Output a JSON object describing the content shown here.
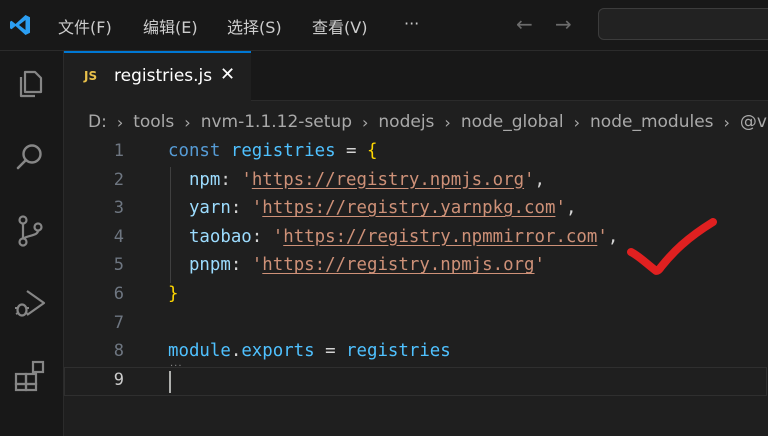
{
  "menu": {
    "file": "文件(F)",
    "edit": "编辑(E)",
    "selection": "选择(S)",
    "view": "查看(V)",
    "more": "···"
  },
  "nav": {
    "back": "←",
    "forward": "→"
  },
  "tab": {
    "badge": "JS",
    "filename": "registries.js",
    "close": "✕"
  },
  "breadcrumb": [
    "D:",
    "tools",
    "nvm-1.1.12-setup",
    "nodejs",
    "node_global",
    "node_modules",
    "@vu"
  ],
  "lines": [
    {
      "n": "1",
      "parts": [
        {
          "t": "const",
          "c": "kw"
        },
        {
          "t": " "
        },
        {
          "t": "registries",
          "c": "var"
        },
        {
          "t": " = ",
          "c": "op"
        },
        {
          "t": "{",
          "c": "brace"
        }
      ]
    },
    {
      "n": "2",
      "parts": [
        {
          "t": "  "
        },
        {
          "t": "npm",
          "c": "prop"
        },
        {
          "t": ": ",
          "c": "op"
        },
        {
          "t": "'",
          "c": "str"
        },
        {
          "t": "https://registry.npmjs.org",
          "c": "url"
        },
        {
          "t": "'",
          "c": "str"
        },
        {
          "t": ",",
          "c": "op"
        }
      ]
    },
    {
      "n": "3",
      "parts": [
        {
          "t": "  "
        },
        {
          "t": "yarn",
          "c": "prop"
        },
        {
          "t": ": ",
          "c": "op"
        },
        {
          "t": "'",
          "c": "str"
        },
        {
          "t": "https://registry.yarnpkg.com",
          "c": "url"
        },
        {
          "t": "'",
          "c": "str"
        },
        {
          "t": ",",
          "c": "op"
        }
      ]
    },
    {
      "n": "4",
      "parts": [
        {
          "t": "  "
        },
        {
          "t": "taobao",
          "c": "prop"
        },
        {
          "t": ": ",
          "c": "op"
        },
        {
          "t": "'",
          "c": "str"
        },
        {
          "t": "https://registry.npmmirror.com",
          "c": "url"
        },
        {
          "t": "'",
          "c": "str"
        },
        {
          "t": ",",
          "c": "op"
        }
      ]
    },
    {
      "n": "5",
      "parts": [
        {
          "t": "  "
        },
        {
          "t": "pnpm",
          "c": "prop"
        },
        {
          "t": ": ",
          "c": "op"
        },
        {
          "t": "'",
          "c": "str"
        },
        {
          "t": "https://registry.npmjs.org",
          "c": "url"
        },
        {
          "t": "'",
          "c": "str"
        }
      ]
    },
    {
      "n": "6",
      "parts": [
        {
          "t": "}",
          "c": "brace"
        }
      ]
    },
    {
      "n": "7",
      "parts": []
    },
    {
      "n": "8",
      "parts": [
        {
          "t": "module",
          "c": "var"
        },
        {
          "t": ".",
          "c": "op"
        },
        {
          "t": "exports",
          "c": "var"
        },
        {
          "t": " = ",
          "c": "op"
        },
        {
          "t": "registries",
          "c": "var"
        }
      ]
    },
    {
      "n": "9",
      "parts": []
    }
  ],
  "current_line": "9",
  "colors": {
    "accent": "#0078d4",
    "annotation": "#e02020"
  }
}
